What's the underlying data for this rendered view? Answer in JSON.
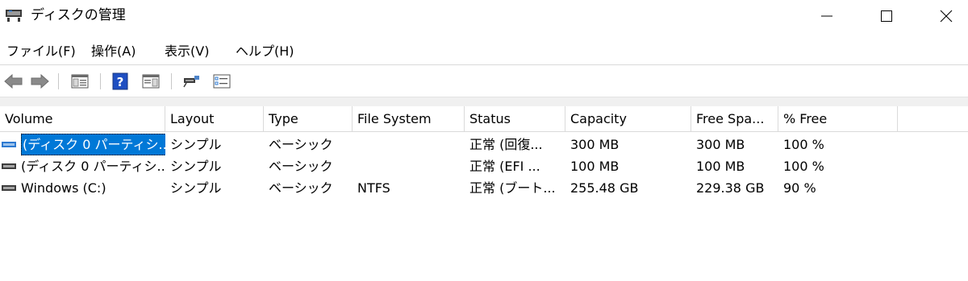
{
  "window": {
    "title": "ディスクの管理",
    "app_icon": "disk-management-icon",
    "controls": {
      "minimize_icon": "minimize-icon",
      "maximize_icon": "maximize-icon",
      "close_icon": "close-icon"
    }
  },
  "menu": {
    "items": [
      "ファイル(F)",
      "操作(A)",
      "表示(V)",
      "ヘルプ(H)"
    ]
  },
  "toolbar": {
    "buttons": [
      "back-arrow-icon",
      "forward-arrow-icon",
      "show-hide-console-tree-icon",
      "help-icon",
      "show-hide-action-pane-icon",
      "connect-icon",
      "properties-icon"
    ]
  },
  "table": {
    "columns": [
      "Volume",
      "Layout",
      "Type",
      "File System",
      "Status",
      "Capacity",
      "Free Spa...",
      "% Free"
    ],
    "rows": [
      {
        "volume": "(ディスク 0 パーティシ...",
        "layout": "シンプル",
        "type": "ベーシック",
        "fs": "",
        "status": "正常 (回復...",
        "capacity": "300 MB",
        "free": "300 MB",
        "pct": "100 %",
        "selected": true
      },
      {
        "volume": "(ディスク 0 パーティシ...",
        "layout": "シンプル",
        "type": "ベーシック",
        "fs": "",
        "status": "正常 (EFI ...",
        "capacity": "100 MB",
        "free": "100 MB",
        "pct": "100 %",
        "selected": false
      },
      {
        "volume": "Windows (C:)",
        "layout": "シンプル",
        "type": "ベーシック",
        "fs": "NTFS",
        "status": "正常 (ブート...",
        "capacity": "255.48 GB",
        "free": "229.38 GB",
        "pct": "90 %",
        "selected": false
      }
    ]
  },
  "colors": {
    "selection": "#0078d7",
    "toolbar_band": "#f0f0f0",
    "help_blue": "#1f4fc2"
  }
}
